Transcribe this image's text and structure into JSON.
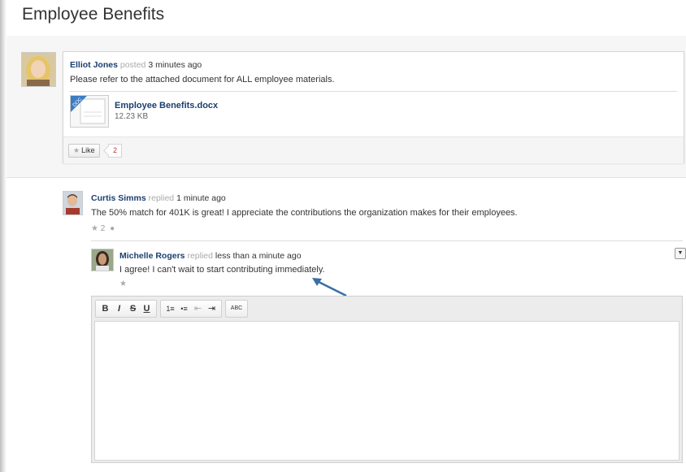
{
  "page": {
    "title": "Employee Benefits"
  },
  "post": {
    "author": "Elliot Jones",
    "verb": "posted",
    "time": "3 minutes ago",
    "message": "Please refer to the attached document for ALL employee materials.",
    "attachment": {
      "name": "Employee Benefits.docx",
      "size": "12.23 KB",
      "thumb_label": "DOC"
    },
    "like_label": "Like",
    "like_count": "2"
  },
  "reply1": {
    "author": "Curtis Simms",
    "verb": "replied",
    "time": "1 minute ago",
    "message": "The 50% match for 401K is great! I appreciate the contributions the organization makes for their employees.",
    "likes": "2"
  },
  "reply2": {
    "author": "Michelle Rogers",
    "verb": "replied",
    "time": "less than a minute ago",
    "message": "I agree! I can't wait to start contributing immediately."
  },
  "editor": {
    "buttons": {
      "bold": "B",
      "italic": "I",
      "strike": "S",
      "underline": "U",
      "ordered_list": "1≡",
      "bullet_list": "•≡",
      "outdent": "⇤",
      "indent": "⇥",
      "spellcheck": "ABC"
    }
  },
  "colors": {
    "link": "#1a3f6f",
    "accent_arrow": "#3a6ea5",
    "badge": "#c0392b"
  }
}
